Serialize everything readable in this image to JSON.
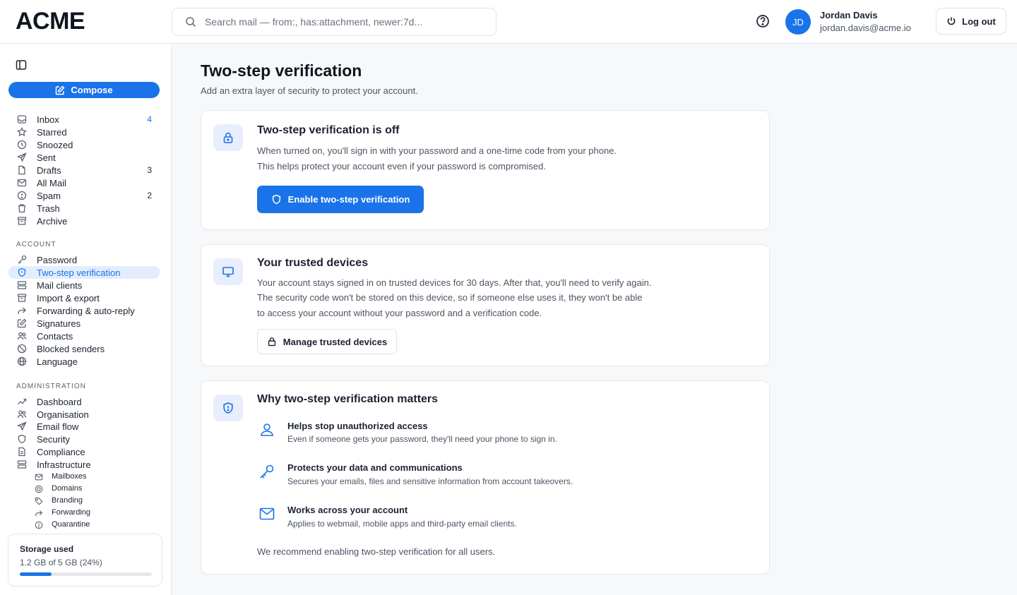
{
  "brand": "ACME",
  "search": {
    "placeholder": "Search mail — from:, has:attachment, newer:7d..."
  },
  "user": {
    "initials": "JD",
    "name": "Jordan Davis",
    "email": "jordan.davis@acme.io"
  },
  "header": {
    "logout_label": "Log out"
  },
  "sidebar": {
    "compose_label": "Compose",
    "mail_items": [
      {
        "label": "Inbox",
        "count": "4",
        "icon": "inbox-icon"
      },
      {
        "label": "Starred",
        "count": "",
        "icon": "star-icon"
      },
      {
        "label": "Snoozed",
        "count": "",
        "icon": "clock-icon"
      },
      {
        "label": "Sent",
        "count": "",
        "icon": "send-icon"
      },
      {
        "label": "Drafts",
        "count": "3",
        "icon": "draft-icon"
      },
      {
        "label": "All Mail",
        "count": "",
        "icon": "mail-icon"
      },
      {
        "label": "Spam",
        "count": "2",
        "icon": "spam-icon"
      },
      {
        "label": "Trash",
        "count": "",
        "icon": "trash-icon"
      },
      {
        "label": "Archive",
        "count": "",
        "icon": "archive-icon"
      }
    ],
    "account_title": "ACCOUNT",
    "account_items": [
      {
        "label": "Password",
        "icon": "key-icon"
      },
      {
        "label": "Two-step verification",
        "icon": "shield-icon",
        "active": true
      },
      {
        "label": "Mail clients",
        "icon": "server-icon"
      },
      {
        "label": "Import & export",
        "icon": "archive-icon"
      },
      {
        "label": "Forwarding & auto-reply",
        "icon": "forward-icon"
      },
      {
        "label": "Signatures",
        "icon": "pen-icon"
      },
      {
        "label": "Contacts",
        "icon": "contacts-icon"
      },
      {
        "label": "Blocked senders",
        "icon": "block-icon"
      },
      {
        "label": "Language",
        "icon": "globe-icon"
      }
    ],
    "admin_title": "ADMINISTRATION",
    "admin_items": [
      {
        "label": "Dashboard",
        "icon": "chart-icon"
      },
      {
        "label": "Organisation",
        "icon": "users-icon"
      },
      {
        "label": "Email flow",
        "icon": "send-icon"
      },
      {
        "label": "Security",
        "icon": "shield-icon"
      },
      {
        "label": "Compliance",
        "icon": "document-icon"
      },
      {
        "label": "Infrastructure",
        "icon": "server-icon"
      }
    ],
    "infra_sub_items": [
      {
        "label": "Mailboxes",
        "icon": "mail-icon"
      },
      {
        "label": "Domains",
        "icon": "globe-icon"
      },
      {
        "label": "Branding",
        "icon": "tag-icon"
      },
      {
        "label": "Forwarding",
        "icon": "forward-icon"
      },
      {
        "label": "Quarantine",
        "icon": "alert-icon"
      }
    ],
    "storage": {
      "title": "Storage used",
      "summary": "1.2 GB of 5 GB (24%)",
      "percent": 24
    }
  },
  "main": {
    "title": "Two-step verification",
    "subtitle": "Add an extra layer of security to protect your account.",
    "status_card": {
      "title": "Two-step verification is off",
      "lines": [
        "When turned on, you'll sign in with your password and a one-time code from your phone.",
        "This helps protect your account even if your password is compromised."
      ],
      "button_label": "Enable two-step verification"
    },
    "devices_card": {
      "title": "Your trusted devices",
      "lines": [
        "Your account stays signed in on trusted devices for 30 days. After that, you'll need to verify again.",
        "The security code won't be stored on this device, so if someone else uses it, they won't be able",
        "to access your account without your password and a verification code."
      ],
      "button_label": "Manage trusted devices"
    },
    "why_card": {
      "title": "Why two-step verification matters",
      "features": [
        {
          "title": "Helps stop unauthorized access",
          "desc": "Even if someone gets your password, they'll need your phone to sign in.",
          "icon": "user-icon"
        },
        {
          "title": "Protects your data and communications",
          "desc": "Secures your emails, files and sensitive information from account takeovers.",
          "icon": "key-icon"
        },
        {
          "title": "Works across your account",
          "desc": "Applies to webmail, mobile apps and third-party email clients.",
          "icon": "mail-icon"
        }
      ],
      "recommendation": "We recommend enabling two-step verification for all users."
    }
  },
  "colors": {
    "accent": "#1a73e8",
    "active_bg": "#e3edfd",
    "tile_bg": "#e8eefb"
  }
}
